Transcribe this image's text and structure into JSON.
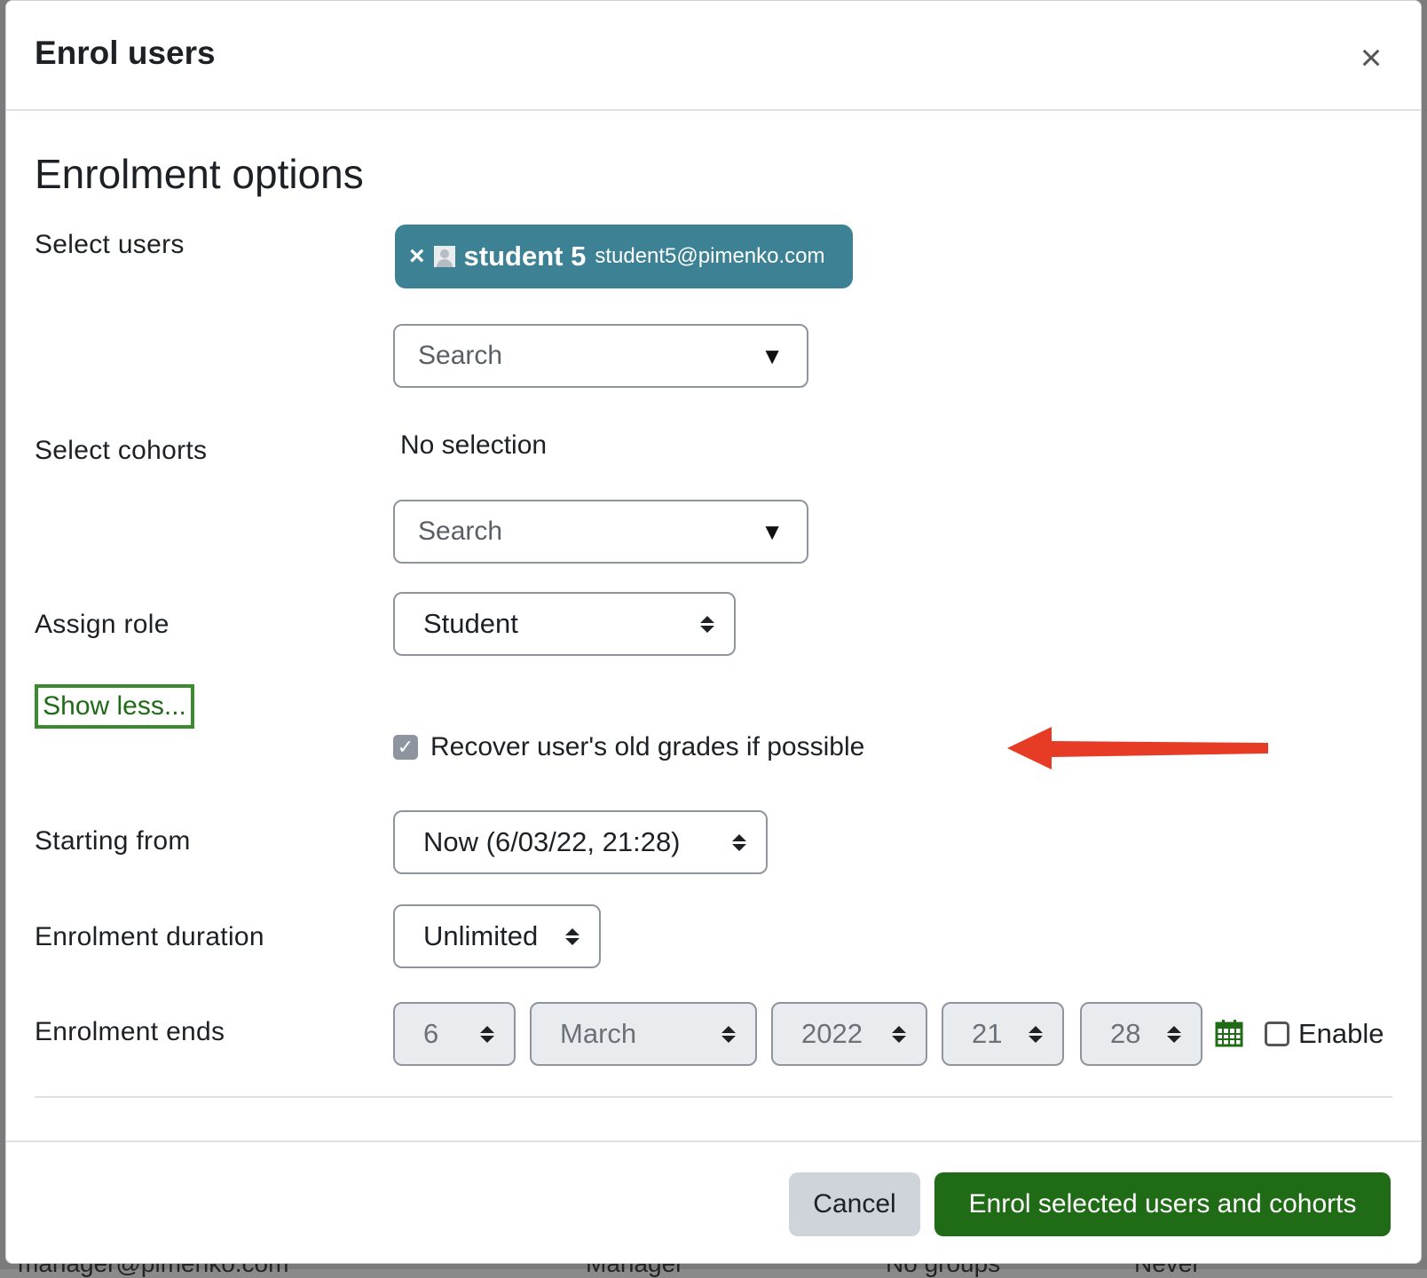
{
  "backdrop": {
    "text_1": "manager@pimenko.com",
    "text_2": "Manager",
    "text_3": "No groups",
    "text_4": "Never"
  },
  "modal": {
    "title": "Enrol users",
    "close_icon": "×"
  },
  "form": {
    "section_title": "Enrolment options",
    "select_users_label": "Select users",
    "selected_user": {
      "remove": "×",
      "name": "student 5",
      "email": "student5@pimenko.com"
    },
    "users_search_placeholder": "Search",
    "select_cohorts_label": "Select cohorts",
    "cohorts_value": "No selection",
    "cohorts_search_placeholder": "Search",
    "dropdown_arrow": "▼",
    "assign_role_label": "Assign role",
    "assign_role_value": "Student",
    "show_less_link": "Show less...",
    "recover_grades_label": "Recover user's old grades if possible",
    "recover_grades_checked": true,
    "checkmark": "✓",
    "starting_from_label": "Starting from",
    "starting_from_value": "Now (6/03/22, 21:28)",
    "duration_label": "Enrolment duration",
    "duration_value": "Unlimited",
    "ends_label": "Enrolment ends",
    "ends_day": "6",
    "ends_month": "March",
    "ends_year": "2022",
    "ends_hour": "21",
    "ends_minute": "28",
    "enable_label": "Enable",
    "enable_checked": false
  },
  "footer": {
    "cancel_label": "Cancel",
    "submit_label": "Enrol selected users and cohorts"
  },
  "icons": {
    "close": "close-icon",
    "remove": "remove-icon",
    "avatar": "user-avatar-icon",
    "dropdown": "chevron-down-icon",
    "select_arrows": "sort-icon",
    "calendar": "calendar-icon",
    "annotation": "arrow-left-icon"
  },
  "colors": {
    "chip_bg": "#3c8194",
    "primary": "#1f6b16",
    "annotation_arrow": "#e63b24"
  }
}
